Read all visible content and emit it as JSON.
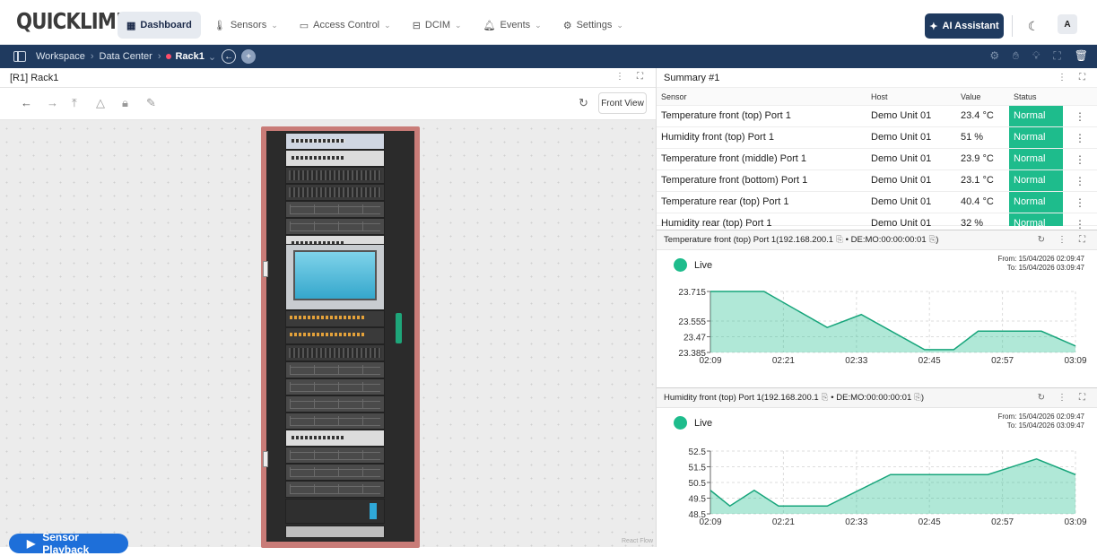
{
  "app": {
    "logo": "QUICKLIME"
  },
  "nav": [
    {
      "label": "Dashboard",
      "icon": "grid-icon"
    },
    {
      "label": "Sensors",
      "icon": "thermometer-icon"
    },
    {
      "label": "Access Control",
      "icon": "card-icon"
    },
    {
      "label": "DCIM",
      "icon": "server-icon"
    },
    {
      "label": "Events",
      "icon": "bell-icon"
    },
    {
      "label": "Settings",
      "icon": "gear-icon"
    }
  ],
  "ai_button": "AI Assistant",
  "user_initial": "A",
  "breadcrumb": {
    "items": [
      "Workspace",
      "Data Center"
    ],
    "active": "Rack1"
  },
  "left_panel": {
    "title": "[R1] Rack1",
    "front_view_label": "Front View",
    "playback_label": "Sensor Playback",
    "attribution": "React Flow"
  },
  "summary": {
    "title": "Summary #1",
    "headers": [
      "Sensor",
      "Host",
      "Value",
      "Status"
    ],
    "rows": [
      {
        "sensor": "Temperature front (top) Port 1",
        "host": "Demo Unit 01",
        "value": "23.4 °C",
        "status": "Normal"
      },
      {
        "sensor": "Humidity front (top) Port 1",
        "host": "Demo Unit 01",
        "value": "51 %",
        "status": "Normal"
      },
      {
        "sensor": "Temperature front (middle) Port 1",
        "host": "Demo Unit 01",
        "value": "23.9 °C",
        "status": "Normal"
      },
      {
        "sensor": "Temperature front (bottom) Port 1",
        "host": "Demo Unit 01",
        "value": "23.1 °C",
        "status": "Normal"
      },
      {
        "sensor": "Temperature rear (top) Port 1",
        "host": "Demo Unit 01",
        "value": "40.4 °C",
        "status": "Normal"
      },
      {
        "sensor": "Humidity rear (top) Port 1",
        "host": "Demo Unit 01",
        "value": "32 %",
        "status": "Normal"
      }
    ]
  },
  "chart_data": [
    {
      "type": "area",
      "title": "Temperature front (top) Port 1(192.168.200.1",
      "title_suffix": "DE:MO:00:00:00:01",
      "live_label": "Live",
      "from": "From: 15/04/2026 02:09:47",
      "to": "To: 15/04/2026 03:09:47",
      "x_ticks": [
        "02:09",
        "02:21",
        "02:33",
        "02:45",
        "02:57",
        "03:09"
      ],
      "y_ticks": [
        23.385,
        23.47,
        23.555,
        23.715
      ],
      "ylim": [
        23.385,
        23.715
      ],
      "x": [
        0,
        11,
        18,
        24,
        31,
        35,
        41,
        47,
        55
      ],
      "y": [
        23.715,
        23.715,
        23.63,
        23.52,
        23.59,
        23.4,
        23.4,
        23.5,
        23.5,
        23.42
      ],
      "points": [
        [
          0,
          23.715
        ],
        [
          11,
          23.715
        ],
        [
          24,
          23.52
        ],
        [
          31,
          23.59
        ],
        [
          44,
          23.4
        ],
        [
          50,
          23.4
        ],
        [
          55,
          23.5
        ],
        [
          68,
          23.5
        ],
        [
          75,
          23.42
        ]
      ],
      "color": "#1ebc8c"
    },
    {
      "type": "area",
      "title": "Humidity front (top) Port 1(192.168.200.1",
      "title_suffix": "DE:MO:00:00:00:01",
      "live_label": "Live",
      "from": "From: 15/04/2026 02:09:47",
      "to": "To: 15/04/2026 03:09:47",
      "x_ticks": [
        "02:09",
        "02:21",
        "02:33",
        "02:45",
        "02:57",
        "03:09"
      ],
      "y_ticks": [
        48.5,
        49.5,
        50.5,
        51.5,
        52.5
      ],
      "ylim": [
        48.5,
        52.5
      ],
      "points": [
        [
          0,
          50
        ],
        [
          4,
          49
        ],
        [
          9,
          50
        ],
        [
          14,
          49
        ],
        [
          24,
          49
        ],
        [
          37,
          51
        ],
        [
          57,
          51
        ],
        [
          67,
          52
        ],
        [
          75,
          51
        ]
      ],
      "color": "#1ebc8c"
    }
  ]
}
